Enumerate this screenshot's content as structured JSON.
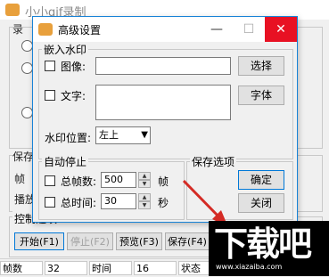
{
  "main": {
    "title": "小小gif录制",
    "partial_record": "录",
    "partial_save": "保存",
    "partial_frames": "帧",
    "partial_play": "播放",
    "control_group": "控制选项",
    "buttons": {
      "start": "开始(F1)",
      "stop": "停止(F2)",
      "preview": "预览(F3)",
      "save": "保存(F4)"
    },
    "status": {
      "frames_label": "帧数",
      "frames_value": "32",
      "time_label": "时间",
      "time_value": "16",
      "status_label": "状态"
    }
  },
  "dialog": {
    "title": "高级设置",
    "watermark_group": "嵌入水印",
    "image_label": "图像:",
    "image_value": "",
    "select_button": "选择",
    "text_label": "文字:",
    "text_value": "",
    "font_button": "字体",
    "position_label": "水印位置:",
    "position_value": "左上",
    "autostop_group": "自动停止",
    "total_frames_label": "总帧数:",
    "total_frames_value": "500",
    "frames_unit": "帧",
    "total_time_label": "总时间:",
    "total_time_value": "30",
    "seconds_unit": "秒",
    "save_group": "保存选项",
    "ok_button": "确定",
    "close_button": "关闭",
    "caption_minimize": "—",
    "caption_maximize": "☐",
    "caption_close": "✕"
  },
  "watermark": {
    "text": "下载吧",
    "sub": "www.xiazaiba.com"
  },
  "colors": {
    "accent": "#1883d7",
    "close": "#e81123",
    "arrow": "#d42b25",
    "app_icon": "#e8a03c"
  }
}
